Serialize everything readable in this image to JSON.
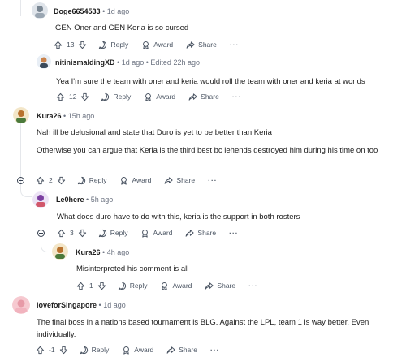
{
  "comments": [
    {
      "author": "Doge6654533",
      "time": "1d ago",
      "body": "GEN Oner and GEN Keria is so cursed",
      "votes": "13",
      "reply": "Reply",
      "award": "Award",
      "share": "Share"
    },
    {
      "author": "nitinismaldingXD",
      "time": "1d ago",
      "edited": "Edited 22h ago",
      "body": "Yea I'm sure the team with oner and keria would roll the team with oner and keria at worlds",
      "votes": "12",
      "reply": "Reply",
      "award": "Award",
      "share": "Share"
    },
    {
      "author": "Kura26",
      "time": "15h ago",
      "body": "Nah ill be delusional and state that Duro is yet to be better than Keria",
      "body2": "Otherwise you can argue that Keria is the third best bc lehends destroyed him during his time on too",
      "votes": "2",
      "reply": "Reply",
      "award": "Award",
      "share": "Share"
    },
    {
      "author": "Le0here",
      "time": "5h ago",
      "body": "What does duro have to do with this, keria is the support in both rosters",
      "votes": "3",
      "reply": "Reply",
      "award": "Award",
      "share": "Share"
    },
    {
      "author": "Kura26",
      "time": "4h ago",
      "body": "Misinterpreted his comment is all",
      "votes": "1",
      "reply": "Reply",
      "award": "Award",
      "share": "Share"
    },
    {
      "author": "loveforSingapore",
      "time": "1d ago",
      "body": "The final boss in a nations based tournament is BLG. Against the LPL, team 1 is way better. Even individually.",
      "votes": "-1",
      "reply": "Reply",
      "award": "Award",
      "share": "Share"
    }
  ],
  "separator": "•",
  "more_label": "···",
  "colors": {
    "meta_gray": "#6b7280",
    "thread_line": "#e5e7eb",
    "text": "#1c1c1c"
  },
  "icons": [
    "upvote-icon",
    "downvote-icon",
    "reply-icon",
    "award-icon",
    "share-icon",
    "collapse-icon",
    "more-icon"
  ]
}
